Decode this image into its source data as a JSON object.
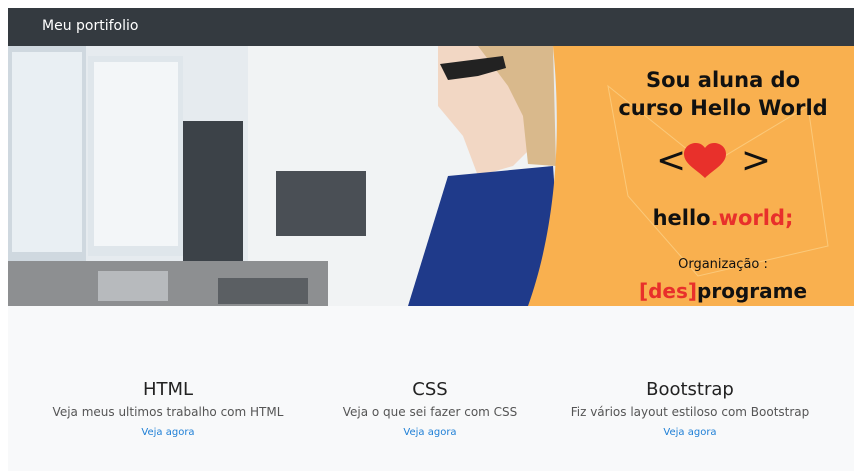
{
  "navbar": {
    "brand": "Meu portifolio"
  },
  "hero": {
    "line1": "Sou aluna do",
    "line2": "curso Hello World",
    "symbol_left": "<",
    "symbol_right": ">",
    "hello": "hello",
    "dot": ".",
    "world": "world",
    "semicolon": ";",
    "org_label": "Organização :",
    "org_bracket_open": "[",
    "org_des": "des",
    "org_bracket_close": "]",
    "org_programe": "programe",
    "colors": {
      "orange": "#f9b04f",
      "red": "#e8302b",
      "dark": "#111111"
    }
  },
  "cards": [
    {
      "title": "HTML",
      "text": "Veja meus ultimos trabalho com HTML",
      "link": "Veja agora"
    },
    {
      "title": "CSS",
      "text": "Veja o que sei fazer com CSS",
      "link": "Veja agora"
    },
    {
      "title": "Bootstrap",
      "text": "Fiz vários layout estiloso com Bootstrap",
      "link": "Veja agora"
    }
  ],
  "colors": {
    "navbar_bg": "#343a40",
    "link": "#1e7fd6",
    "page_bg": "#f8f9fa"
  }
}
